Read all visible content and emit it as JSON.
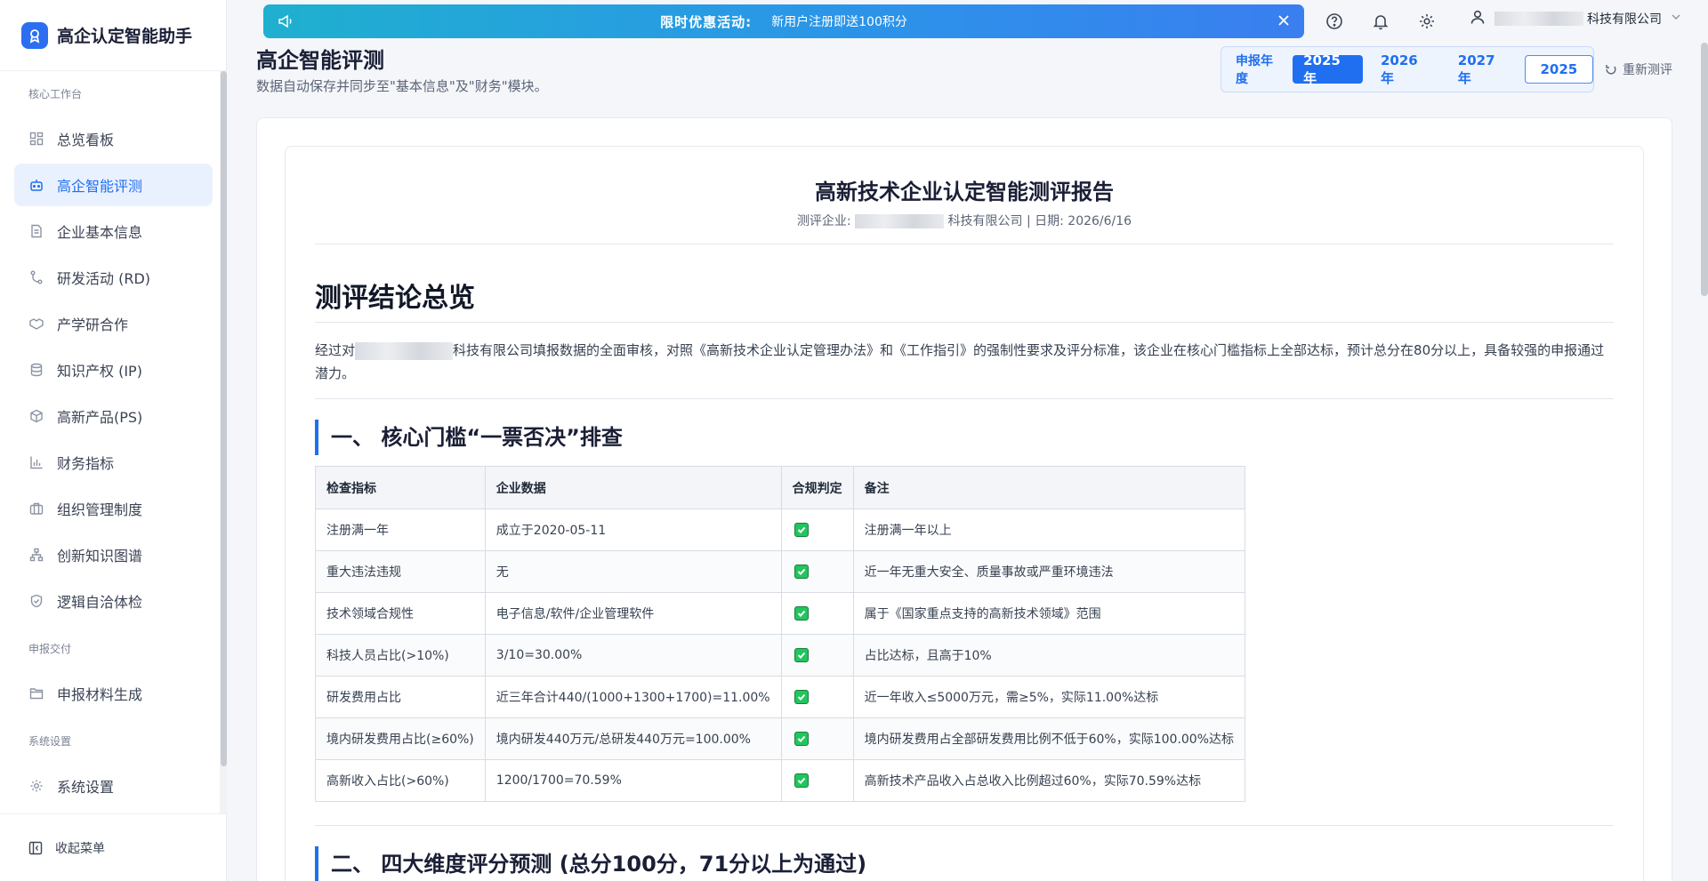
{
  "app": {
    "title": "高企认定智能助手"
  },
  "sidebar": {
    "groups": [
      {
        "title": "核心工作台"
      },
      {
        "title": "申报交付"
      },
      {
        "title": "系统设置"
      }
    ],
    "items": [
      {
        "label": "总览看板",
        "icon": "dashboard-icon"
      },
      {
        "label": "高企智能评测",
        "icon": "robot-icon"
      },
      {
        "label": "企业基本信息",
        "icon": "document-icon"
      },
      {
        "label": "研发活动 (RD)",
        "icon": "branch-icon"
      },
      {
        "label": "产学研合作",
        "icon": "handshake-icon"
      },
      {
        "label": "知识产权 (IP)",
        "icon": "database-icon"
      },
      {
        "label": "高新产品(PS)",
        "icon": "box-icon"
      },
      {
        "label": "财务指标",
        "icon": "bar-chart-icon"
      },
      {
        "label": "组织管理制度",
        "icon": "briefcase-icon"
      },
      {
        "label": "创新知识图谱",
        "icon": "network-icon"
      },
      {
        "label": "逻辑自洽体检",
        "icon": "shield-check-icon"
      },
      {
        "label": "申报材料生成",
        "icon": "folder-icon"
      },
      {
        "label": "系统设置",
        "icon": "gear-icon"
      }
    ],
    "collapse_label": "收起菜单"
  },
  "banner": {
    "title": "限时优惠活动:",
    "text": "新用户注册即送100积分"
  },
  "user": {
    "company_suffix": "科技有限公司"
  },
  "page": {
    "title": "高企智能评测",
    "subtitle": "数据自动保存并同步至\"基本信息\"及\"财务\"模块。"
  },
  "year_selector": {
    "label": "申报年度",
    "options": [
      "2025年",
      "2026年",
      "2027年"
    ],
    "selected": "2025年",
    "input_value": "2025"
  },
  "retest_label": "重新测评",
  "report": {
    "title": "高新技术企业认定智能测评报告",
    "meta_prefix": "测评企业:",
    "meta_suffix": "科技有限公司 | 日期: 2026/6/16",
    "section_overview": "测评结论总览",
    "para_prefix": "经过对",
    "para_suffix": "科技有限公司填报数据的全面审核，对照《高新技术企业认定管理办法》和《工作指引》的强制性要求及评分标准，该企业在核心门槛指标上全部达标，预计总分在80分以上，具备较强的申报通过潜力。",
    "section1": "一、 核心门槛“一票否决”排查",
    "section2": "二、 四大维度评分预测 (总分100分，71分以上为通过)",
    "table": {
      "headers": [
        "检查指标",
        "企业数据",
        "合规判定",
        "备注"
      ],
      "rows": [
        {
          "indicator": "注册满一年",
          "data": "成立于2020-05-11",
          "note": "注册满一年以上"
        },
        {
          "indicator": "重大违法违规",
          "data": "无",
          "note": "近一年无重大安全、质量事故或严重环境违法"
        },
        {
          "indicator": "技术领域合规性",
          "data": "电子信息/软件/企业管理软件",
          "note": "属于《国家重点支持的高新技术领域》范围"
        },
        {
          "indicator": "科技人员占比(>10%)",
          "data": "3/10=30.00%",
          "note": "占比达标，且高于10%"
        },
        {
          "indicator": "研发费用占比",
          "data": "近三年合计440/(1000+1300+1700)=11.00%",
          "note": "近一年收入≤5000万元，需≥5%，实际11.00%达标"
        },
        {
          "indicator": "境内研发费用占比(≥60%)",
          "data": "境内研发440万元/总研发440万元=100.00%",
          "note": "境内研发费用占全部研发费用比例不低于60%，实际100.00%达标"
        },
        {
          "indicator": "高新收入占比(>60%)",
          "data": "1200/1700=70.59%",
          "note": "高新技术产品收入占总收入比例超过60%，实际70.59%达标"
        }
      ]
    }
  }
}
